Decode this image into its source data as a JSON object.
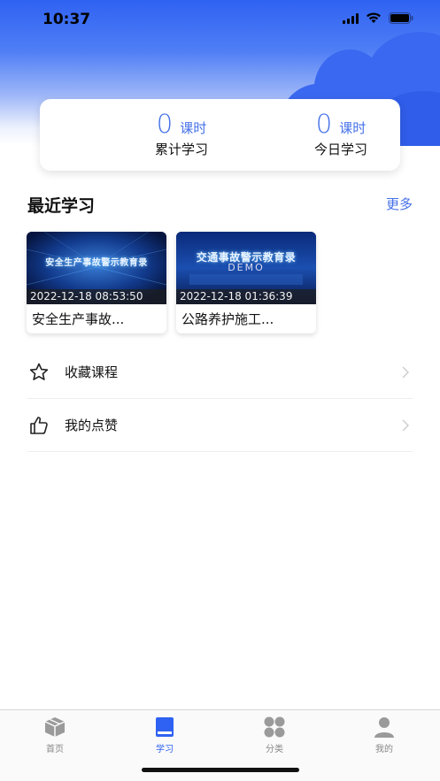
{
  "status_bar": {
    "time": "10:37"
  },
  "stats": {
    "total": {
      "value": "0",
      "unit": "课时",
      "label": "累计学习"
    },
    "today": {
      "value": "0",
      "unit": "课时",
      "label": "今日学习"
    }
  },
  "recent": {
    "title": "最近学习",
    "more": "更多",
    "courses": [
      {
        "thumb_text": "安全生产事故警示教育录",
        "timestamp": "2022-12-18 08:53:50",
        "name": "安全生产事故..."
      },
      {
        "thumb_text": "交通事故警示教育录",
        "thumb_sub": "DEMO",
        "timestamp": "2022-12-18 01:36:39",
        "name": "公路养护施工..."
      }
    ]
  },
  "menu": [
    {
      "label": "收藏课程",
      "icon": "star-icon"
    },
    {
      "label": "我的点赞",
      "icon": "thumbs-up-icon"
    }
  ],
  "tabbar": [
    {
      "label": "首页",
      "icon": "box-icon",
      "active": false
    },
    {
      "label": "学习",
      "icon": "book-icon",
      "active": true
    },
    {
      "label": "分类",
      "icon": "grid-icon",
      "active": false
    },
    {
      "label": "我的",
      "icon": "user-icon",
      "active": false
    }
  ],
  "colors": {
    "accent": "#4470e8",
    "hero": "#2f62f2",
    "inactive": "#888888"
  }
}
